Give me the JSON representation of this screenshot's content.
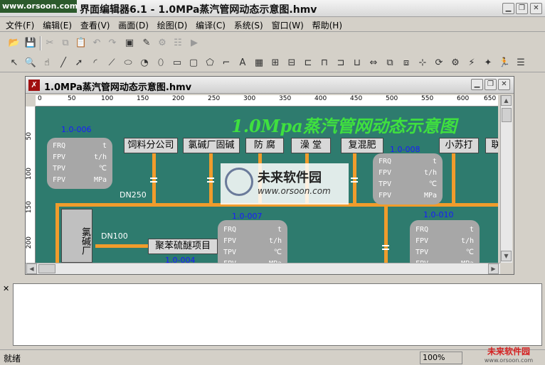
{
  "watermark_top": "www.orsoon.com",
  "app": {
    "title": "界面编辑器6.1 - 1.0MPa蒸汽管网动态示意图.hmv"
  },
  "menu": [
    "文件(F)",
    "编辑(E)",
    "查看(V)",
    "画面(D)",
    "绘图(D)",
    "编译(C)",
    "系统(S)",
    "窗口(W)",
    "帮助(H)"
  ],
  "child": {
    "title": "1.0MPa蒸汽管网动态示意图.hmv"
  },
  "ruler_x": [
    "0",
    "50",
    "100",
    "150",
    "200",
    "250",
    "300",
    "350",
    "400",
    "450",
    "500",
    "550",
    "600",
    "650"
  ],
  "ruler_y": [
    "50",
    "100",
    "150",
    "200"
  ],
  "diagram": {
    "heading": "1.0Mpa蒸汽管网动态示意图",
    "buttons": [
      "饲料分公司",
      "氯碱厂固碱",
      "防 腐",
      "澡 堂",
      "复混肥",
      "小苏打",
      "联"
    ],
    "factory": "氯碱厂",
    "project": "聚苯硫醚项目",
    "dn_main": "DN250",
    "dn_branch": "DN100",
    "tags": {
      "t006": "1.0-006",
      "t007": "1.0-007",
      "t008": "1.0-008",
      "t010": "1.0-010",
      "t004": "1.0-004"
    },
    "rows": [
      {
        "name": "FRQ",
        "unit": "t"
      },
      {
        "name": "FPV",
        "unit": "t/h"
      },
      {
        "name": "TPV",
        "unit": "℃"
      },
      {
        "name": "FPV",
        "unit": "MPa"
      }
    ],
    "watermark": {
      "title": "未来软件园",
      "url": "www.orsoon.com"
    }
  },
  "status": {
    "text": "就绪",
    "zoom": "100%"
  },
  "watermark_bottom": {
    "title": "未来软件园",
    "url": "www.orsoon.com"
  }
}
